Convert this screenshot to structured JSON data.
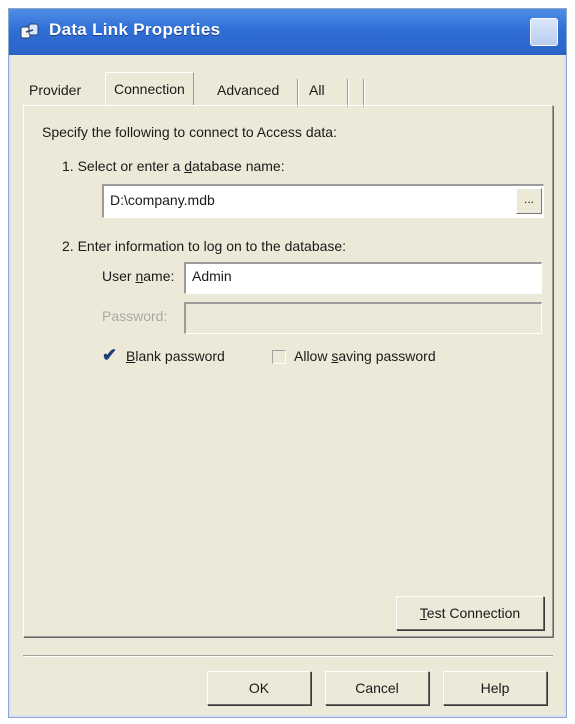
{
  "window": {
    "title": "Data Link Properties"
  },
  "tabs": [
    {
      "label": "Provider",
      "active": false
    },
    {
      "label": "Connection",
      "active": true
    },
    {
      "label": "Advanced",
      "active": false
    },
    {
      "label": "All",
      "active": false
    }
  ],
  "connection": {
    "intro": "Specify the following to connect to Access data:",
    "step1": {
      "label_pre": "1. Select or enter a ",
      "label_hot": "d",
      "label_post": "atabase name:",
      "value": "D:\\company.mdb",
      "browse_label": "..."
    },
    "step2": {
      "label": "2. Enter information to log on to the database:"
    },
    "username": {
      "label_pre": "User ",
      "label_hot": "n",
      "label_post": "ame:",
      "value": "Admin"
    },
    "password": {
      "label": "Password:",
      "value": ""
    },
    "blank_password": {
      "label_hot": "B",
      "label_post": "lank password",
      "checked": true
    },
    "allow_saving": {
      "label_pre": "Allow ",
      "label_hot": "s",
      "label_post": "aving password",
      "checked": false
    },
    "test_connection": {
      "label_hot": "T",
      "label_post": "est Connection"
    }
  },
  "footer": {
    "ok": "OK",
    "cancel": "Cancel",
    "help": "Help"
  },
  "colors": {
    "titlebar": "#2f6fd6",
    "face": "#ece9d8"
  }
}
